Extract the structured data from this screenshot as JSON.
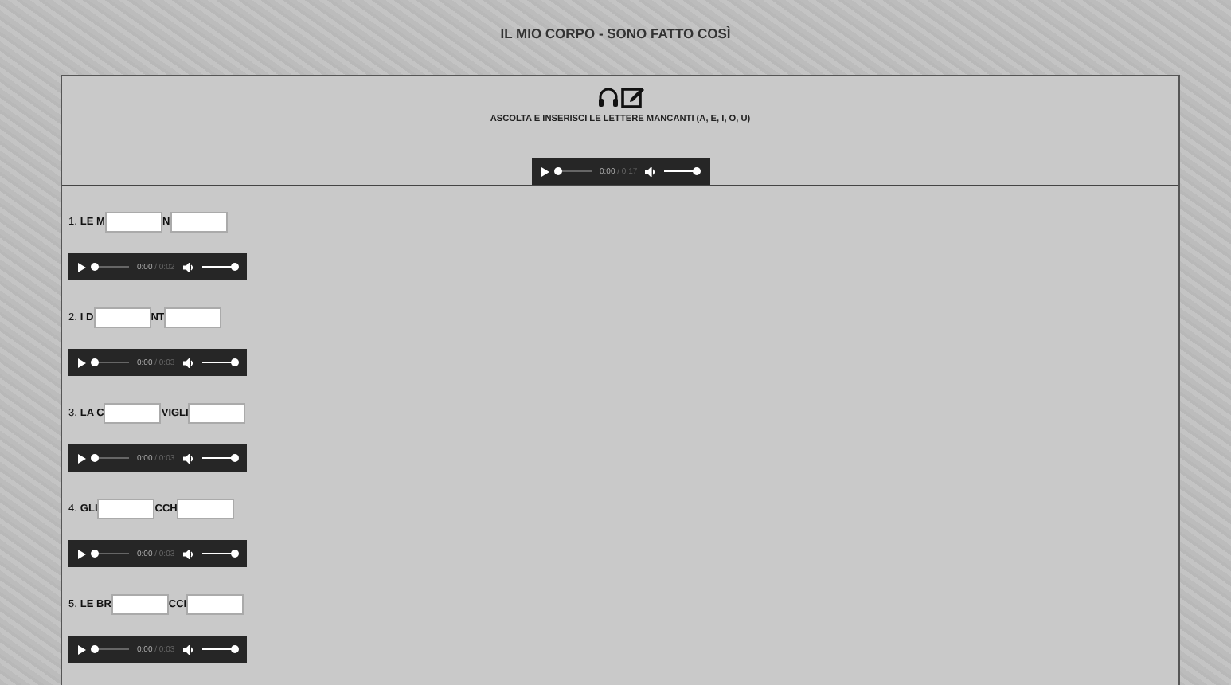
{
  "title": "IL MIO CORPO - SONO FATTO COSÌ",
  "header": {
    "instruction": "ASCOLTA E INSERISCI LE LETTERE MANCANTI (A, E, I, O, U)",
    "player": {
      "time": "0:00",
      "duration": "/ 0:17",
      "progress": {
        "level": 0
      },
      "volume": {
        "level": 1
      }
    }
  },
  "items": [
    {
      "number": "1.",
      "segments": [
        {
          "kind": "text",
          "text": "LE M"
        },
        {
          "kind": "blank"
        },
        {
          "kind": "text",
          "text": "N"
        },
        {
          "kind": "blank"
        }
      ],
      "player": {
        "time": "0:00",
        "duration": "/ 0:02",
        "progress": {
          "level": 0
        },
        "volume": {
          "level": 1
        }
      }
    },
    {
      "number": "2.",
      "segments": [
        {
          "kind": "text",
          "text": "I D"
        },
        {
          "kind": "blank"
        },
        {
          "kind": "text",
          "text": "NT"
        },
        {
          "kind": "blank"
        }
      ],
      "player": {
        "time": "0:00",
        "duration": "/ 0:03",
        "progress": {
          "level": 0
        },
        "volume": {
          "level": 1
        }
      }
    },
    {
      "number": "3.",
      "segments": [
        {
          "kind": "text",
          "text": "LA C"
        },
        {
          "kind": "blank"
        },
        {
          "kind": "text",
          "text": "VIGLI"
        },
        {
          "kind": "blank"
        }
      ],
      "player": {
        "time": "0:00",
        "duration": "/ 0:03",
        "progress": {
          "level": 0
        },
        "volume": {
          "level": 1
        }
      }
    },
    {
      "number": "4.",
      "segments": [
        {
          "kind": "text",
          "text": "GLI"
        },
        {
          "kind": "blank"
        },
        {
          "kind": "text",
          "text": "CCH"
        },
        {
          "kind": "blank"
        }
      ],
      "player": {
        "time": "0:00",
        "duration": "/ 0:03",
        "progress": {
          "level": 0
        },
        "volume": {
          "level": 1
        }
      }
    },
    {
      "number": "5.",
      "segments": [
        {
          "kind": "text",
          "text": "LE BR"
        },
        {
          "kind": "blank"
        },
        {
          "kind": "text",
          "text": "CCI"
        },
        {
          "kind": "blank"
        }
      ],
      "player": {
        "time": "0:00",
        "duration": "/ 0:03",
        "progress": {
          "level": 0
        },
        "volume": {
          "level": 1
        }
      }
    }
  ]
}
